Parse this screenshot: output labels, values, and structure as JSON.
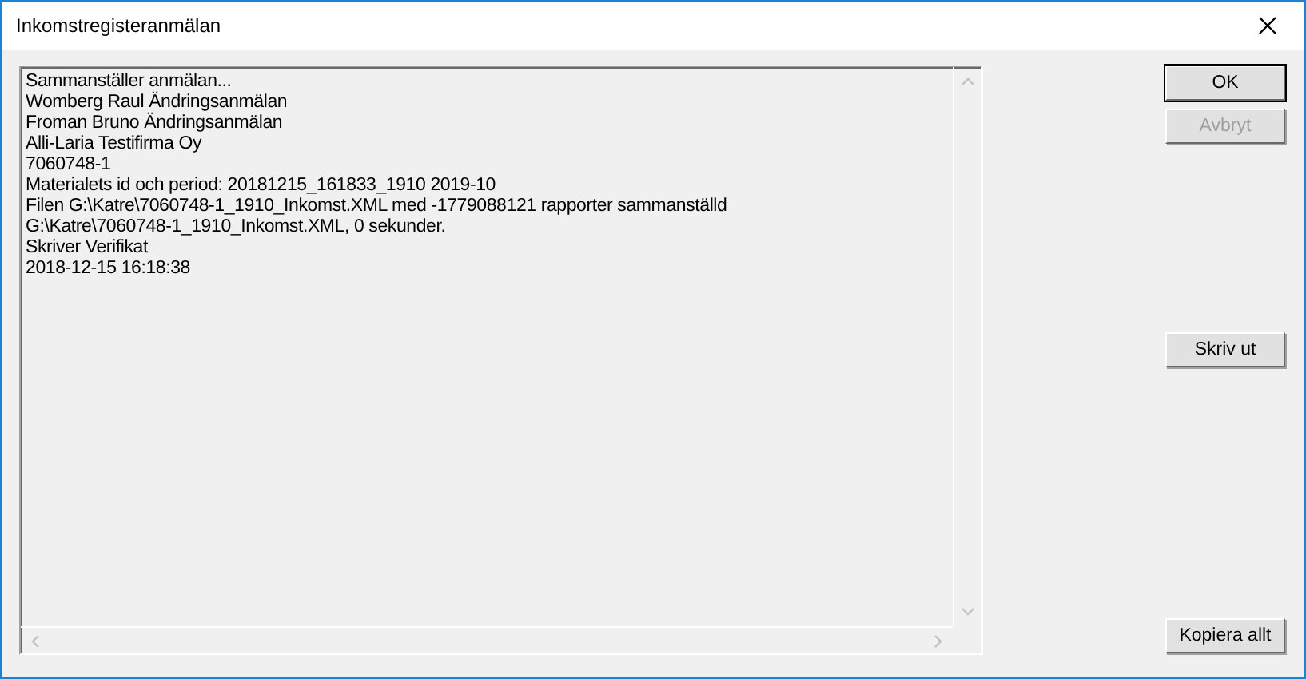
{
  "window": {
    "title": "Inkomstregisteranmälan"
  },
  "log": {
    "lines": [
      "Sammanställer anmälan...",
      "Womberg Raul Ändringsanmälan",
      "Froman Bruno Ändringsanmälan",
      "Alli-Laria Testifirma Oy",
      "7060748-1",
      "Materialets id och period: 20181215_161833_1910 2019-10",
      "Filen G:\\Katre\\7060748-1_1910_Inkomst.XML med -1779088121 rapporter sammanställd",
      "G:\\Katre\\7060748-1_1910_Inkomst.XML, 0 sekunder.",
      "Skriver Verifikat",
      "2018-12-15 16:18:38"
    ]
  },
  "side_buttons": {
    "top": [
      {
        "label": "OK",
        "disabled": false,
        "default": true
      },
      {
        "label": "Avbryt",
        "disabled": true,
        "default": false
      }
    ],
    "middle": [
      {
        "label": "Skriv ut",
        "disabled": false,
        "default": false
      }
    ],
    "bottom": [
      {
        "label": "Kopiera allt",
        "disabled": false,
        "default": false
      }
    ]
  }
}
